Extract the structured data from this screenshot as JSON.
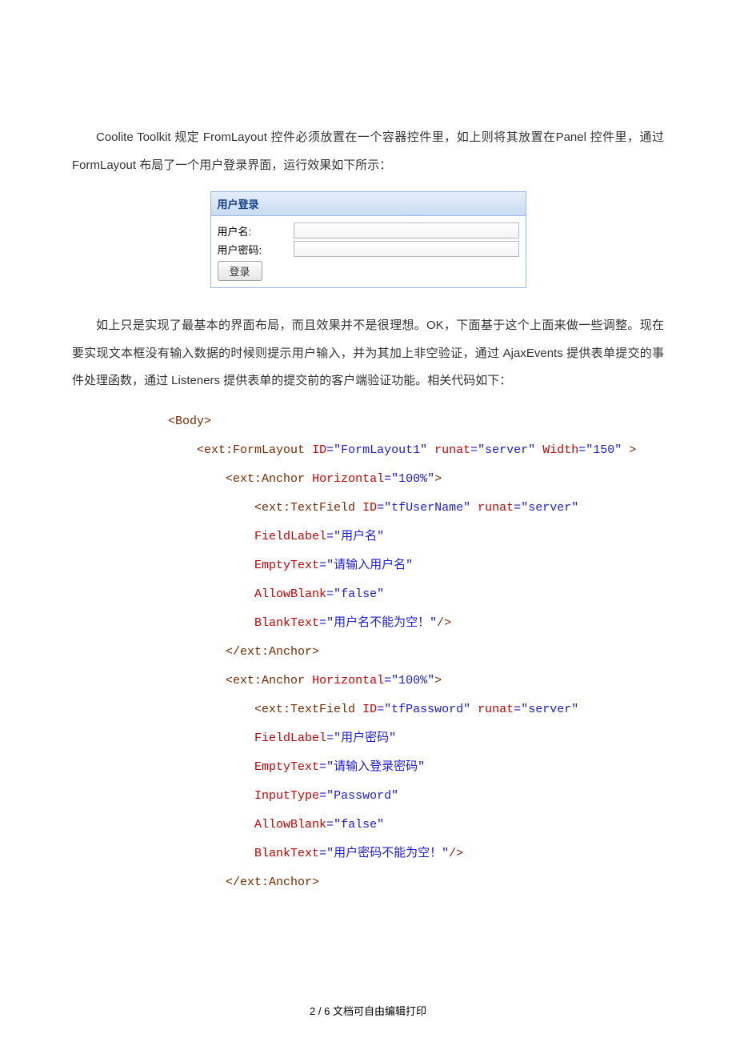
{
  "para1": "Coolite Toolkit 规定 FromLayout 控件必须放置在一个容器控件里，如上则将其放置在Panel 控件里，通过 FormLayout 布局了一个用户登录界面，运行效果如下所示：",
  "panel": {
    "title": "用户登录",
    "userLabel": "用户名:",
    "passLabel": "用户密码:",
    "loginBtn": "登录"
  },
  "para2": "如上只是实现了最基本的界面布局，而且效果并不是很理想。OK，下面基于这个上面来做一些调整。现在要实现文本框没有输入数据的时候则提示用户输入，并为其加上非空验证，通过 AjaxEvents 提供表单提交的事件处理函数，通过 Listeners 提供表单的提交前的客户端验证功能。相关代码如下：",
  "code": {
    "l1": {
      "tag": "<Body>"
    },
    "l2": {
      "tag": "<ext:FormLayout",
      "attr1": "ID",
      "val1": "\"FormLayout1\"",
      "attr2": "runat",
      "val2": "\"server\"",
      "attr3": "Width",
      "val3": "\"150\"",
      "end": " >"
    },
    "l3": {
      "tag": "<ext:Anchor",
      "attr1": "Horizontal",
      "val1": "\"100%\"",
      "end": ">"
    },
    "l4": {
      "tag": "<ext:TextField",
      "attr1": "ID",
      "val1": "\"tfUserName\"",
      "attr2": "runat",
      "val2": "\"server\""
    },
    "l5": {
      "attr": "FieldLabel",
      "val": "\"用户名\""
    },
    "l6": {
      "attr": "EmptyText",
      "val": "\"请输入用户名\""
    },
    "l7": {
      "attr": "AllowBlank",
      "val": "\"false\""
    },
    "l8": {
      "attr": "BlankText",
      "val": "\"用户名不能为空！\"",
      "end": "/>"
    },
    "l9": {
      "tag": "</ext:Anchor>"
    },
    "l10": {
      "tag": "<ext:Anchor",
      "attr1": "Horizontal",
      "val1": "\"100%\"",
      "end": ">"
    },
    "l11": {
      "tag": "<ext:TextField",
      "attr1": "ID",
      "val1": "\"tfPassword\"",
      "attr2": "runat",
      "val2": "\"server\""
    },
    "l12": {
      "attr": "FieldLabel",
      "val": "\"用户密码\""
    },
    "l13": {
      "attr": "EmptyText",
      "val": "\"请输入登录密码\""
    },
    "l14": {
      "attr": "InputType",
      "val": "\"Password\""
    },
    "l15": {
      "attr": "AllowBlank",
      "val": "\"false\""
    },
    "l16": {
      "attr": "BlankText",
      "val": "\"用户密码不能为空！\"",
      "end": "/>"
    },
    "l17": {
      "tag": "</ext:Anchor>"
    }
  },
  "footer": "2 / 6 文档可自由编辑打印"
}
